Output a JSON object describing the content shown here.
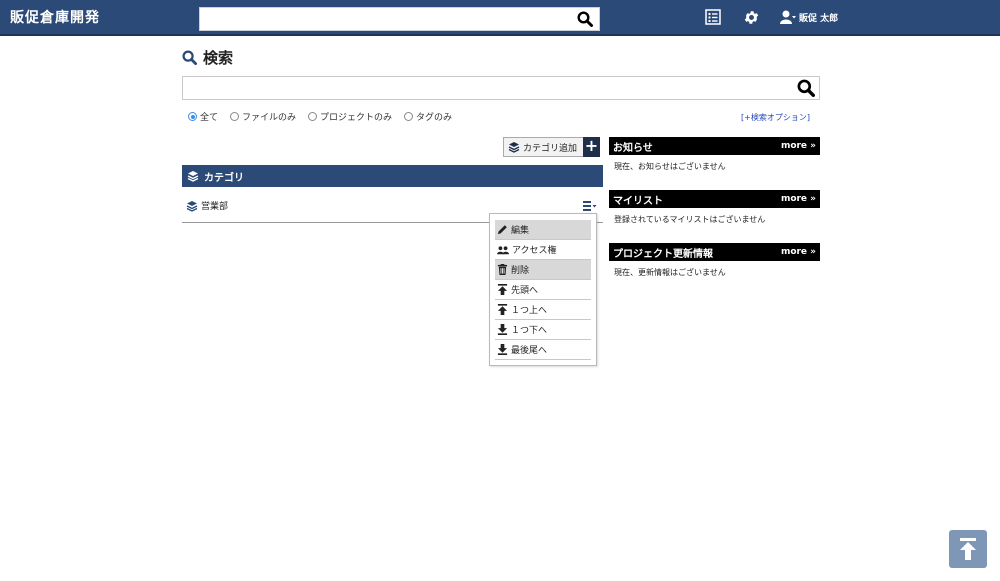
{
  "app": {
    "title": "販促倉庫開発"
  },
  "header": {
    "search_placeholder": "",
    "user_name": "販促 太郎"
  },
  "page": {
    "title": "検索"
  },
  "search": {
    "placeholder": "",
    "filters": [
      {
        "label": "全て",
        "checked": true
      },
      {
        "label": "ファイルのみ",
        "checked": false
      },
      {
        "label": "プロジェクトのみ",
        "checked": false
      },
      {
        "label": "タグのみ",
        "checked": false
      }
    ],
    "options_link": "[+検索オプション]"
  },
  "category": {
    "add_label": "カテゴリ追加",
    "header": "カテゴリ",
    "items": [
      {
        "label": "営業部"
      }
    ]
  },
  "context_menu": {
    "items": [
      {
        "label": "編集",
        "icon": "pencil-icon"
      },
      {
        "label": "アクセス権",
        "icon": "users-icon"
      },
      {
        "label": "削除",
        "icon": "trash-icon"
      },
      {
        "label": "先頭へ",
        "icon": "to-top-icon"
      },
      {
        "label": "１つ上へ",
        "icon": "arrow-up-icon"
      },
      {
        "label": "１つ下へ",
        "icon": "arrow-down-icon"
      },
      {
        "label": "最後尾へ",
        "icon": "to-bottom-icon"
      }
    ]
  },
  "panels": [
    {
      "title": "お知らせ",
      "more": "more »",
      "body": "現在、お知らせはございません"
    },
    {
      "title": "マイリスト",
      "more": "more »",
      "body": "登録されているマイリストはございません"
    },
    {
      "title": "プロジェクト更新情報",
      "more": "more »",
      "body": "現在、更新情報はございません"
    }
  ],
  "colors": {
    "header_bg": "#2b4a78",
    "panel_head": "#000000",
    "accent_link": "#2347b8",
    "scroll_top": "#7f97b7"
  }
}
